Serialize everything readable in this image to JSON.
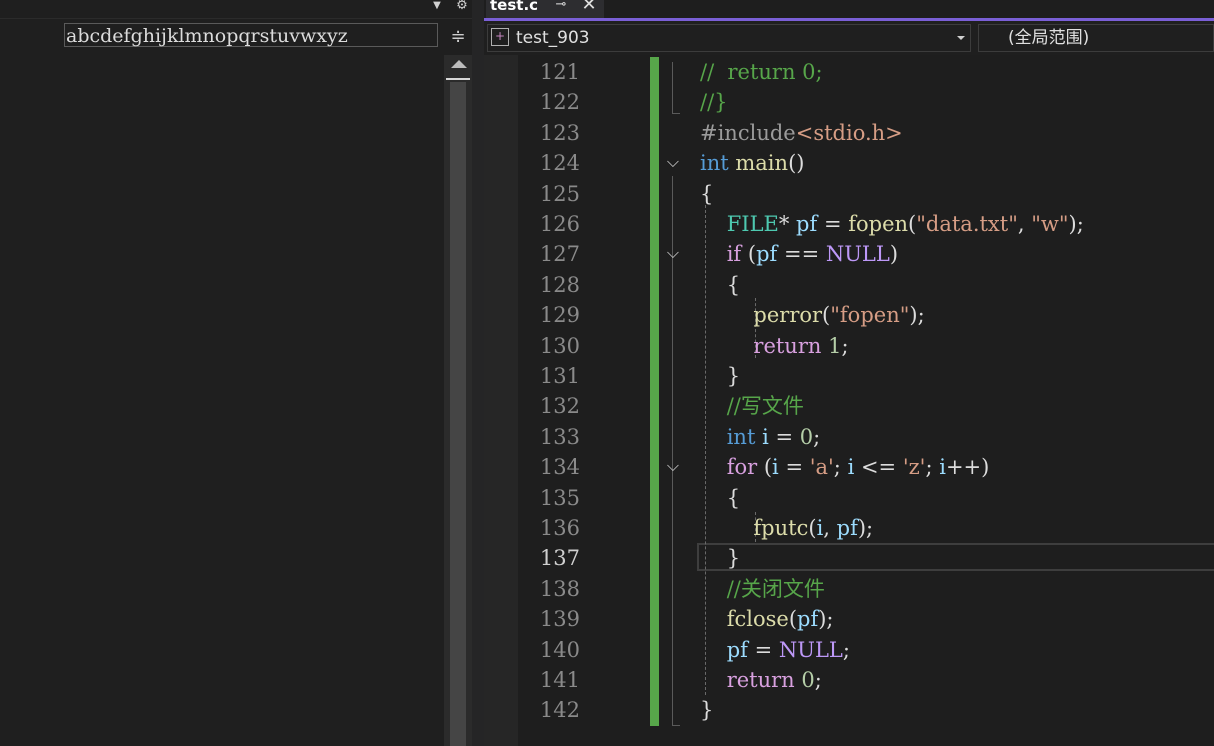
{
  "left_pane": {
    "output_text": "abcdefghijklmnopqrstuvwxyz"
  },
  "tab": {
    "label": "test.c"
  },
  "navbar": {
    "scope": "test_903",
    "global_scope": "(全局范围)"
  },
  "editor": {
    "current_line": "137",
    "lines": [
      {
        "n": "121",
        "tokens": [
          {
            "t": "//  return 0;",
            "c": "cmt"
          }
        ]
      },
      {
        "n": "122",
        "tokens": [
          {
            "t": "//}",
            "c": "cmt"
          }
        ]
      },
      {
        "n": "123",
        "tokens": [
          {
            "t": "#include",
            "c": "pre"
          },
          {
            "t": "<stdio.h>",
            "c": "str"
          }
        ]
      },
      {
        "n": "124",
        "tokens": [
          {
            "t": "int",
            "c": "kw"
          },
          {
            "t": " ",
            "c": ""
          },
          {
            "t": "main",
            "c": "fn"
          },
          {
            "t": "()",
            "c": ""
          }
        ]
      },
      {
        "n": "125",
        "tokens": [
          {
            "t": "{",
            "c": ""
          }
        ]
      },
      {
        "n": "126",
        "tokens": [
          {
            "t": "    ",
            "c": ""
          },
          {
            "t": "FILE",
            "c": "typ"
          },
          {
            "t": "* ",
            "c": ""
          },
          {
            "t": "pf",
            "c": "var"
          },
          {
            "t": " = ",
            "c": ""
          },
          {
            "t": "fopen",
            "c": "fn"
          },
          {
            "t": "(",
            "c": ""
          },
          {
            "t": "\"data.txt\"",
            "c": "str"
          },
          {
            "t": ", ",
            "c": ""
          },
          {
            "t": "\"w\"",
            "c": "str"
          },
          {
            "t": ");",
            "c": ""
          }
        ]
      },
      {
        "n": "127",
        "tokens": [
          {
            "t": "    ",
            "c": ""
          },
          {
            "t": "if",
            "c": "ctl"
          },
          {
            "t": " (",
            "c": ""
          },
          {
            "t": "pf",
            "c": "var"
          },
          {
            "t": " == ",
            "c": ""
          },
          {
            "t": "NULL",
            "c": "mac"
          },
          {
            "t": ")",
            "c": ""
          }
        ]
      },
      {
        "n": "128",
        "tokens": [
          {
            "t": "    {",
            "c": ""
          }
        ]
      },
      {
        "n": "129",
        "tokens": [
          {
            "t": "        ",
            "c": ""
          },
          {
            "t": "perror",
            "c": "fn"
          },
          {
            "t": "(",
            "c": ""
          },
          {
            "t": "\"fopen\"",
            "c": "str"
          },
          {
            "t": ");",
            "c": ""
          }
        ]
      },
      {
        "n": "130",
        "tokens": [
          {
            "t": "        ",
            "c": ""
          },
          {
            "t": "return",
            "c": "ctl"
          },
          {
            "t": " ",
            "c": ""
          },
          {
            "t": "1",
            "c": "num"
          },
          {
            "t": ";",
            "c": ""
          }
        ]
      },
      {
        "n": "131",
        "tokens": [
          {
            "t": "    }",
            "c": ""
          }
        ]
      },
      {
        "n": "132",
        "tokens": [
          {
            "t": "    ",
            "c": ""
          },
          {
            "t": "//写文件",
            "c": "cmt"
          }
        ]
      },
      {
        "n": "133",
        "tokens": [
          {
            "t": "    ",
            "c": ""
          },
          {
            "t": "int",
            "c": "kw"
          },
          {
            "t": " ",
            "c": ""
          },
          {
            "t": "i",
            "c": "var"
          },
          {
            "t": " = ",
            "c": ""
          },
          {
            "t": "0",
            "c": "num"
          },
          {
            "t": ";",
            "c": ""
          }
        ]
      },
      {
        "n": "134",
        "tokens": [
          {
            "t": "    ",
            "c": ""
          },
          {
            "t": "for",
            "c": "ctl"
          },
          {
            "t": " (",
            "c": ""
          },
          {
            "t": "i",
            "c": "var"
          },
          {
            "t": " = ",
            "c": ""
          },
          {
            "t": "'a'",
            "c": "str"
          },
          {
            "t": "; ",
            "c": ""
          },
          {
            "t": "i",
            "c": "var"
          },
          {
            "t": " <= ",
            "c": ""
          },
          {
            "t": "'z'",
            "c": "str"
          },
          {
            "t": "; ",
            "c": ""
          },
          {
            "t": "i",
            "c": "var"
          },
          {
            "t": "++)",
            "c": ""
          }
        ]
      },
      {
        "n": "135",
        "tokens": [
          {
            "t": "    {",
            "c": ""
          }
        ]
      },
      {
        "n": "136",
        "tokens": [
          {
            "t": "        ",
            "c": ""
          },
          {
            "t": "fputc",
            "c": "fn"
          },
          {
            "t": "(",
            "c": ""
          },
          {
            "t": "i",
            "c": "var"
          },
          {
            "t": ", ",
            "c": ""
          },
          {
            "t": "pf",
            "c": "var"
          },
          {
            "t": ");",
            "c": ""
          }
        ]
      },
      {
        "n": "137",
        "tokens": [
          {
            "t": "    }",
            "c": ""
          }
        ]
      },
      {
        "n": "138",
        "tokens": [
          {
            "t": "    ",
            "c": ""
          },
          {
            "t": "//关闭文件",
            "c": "cmt"
          }
        ]
      },
      {
        "n": "139",
        "tokens": [
          {
            "t": "    ",
            "c": ""
          },
          {
            "t": "fclose",
            "c": "fn"
          },
          {
            "t": "(",
            "c": ""
          },
          {
            "t": "pf",
            "c": "var"
          },
          {
            "t": ");",
            "c": ""
          }
        ]
      },
      {
        "n": "140",
        "tokens": [
          {
            "t": "    ",
            "c": ""
          },
          {
            "t": "pf",
            "c": "var"
          },
          {
            "t": " = ",
            "c": ""
          },
          {
            "t": "NULL",
            "c": "mac"
          },
          {
            "t": ";",
            "c": ""
          }
        ]
      },
      {
        "n": "141",
        "tokens": [
          {
            "t": "    ",
            "c": ""
          },
          {
            "t": "return",
            "c": "ctl"
          },
          {
            "t": " ",
            "c": ""
          },
          {
            "t": "0",
            "c": "num"
          },
          {
            "t": ";",
            "c": ""
          }
        ]
      },
      {
        "n": "142",
        "tokens": [
          {
            "t": "}",
            "c": ""
          }
        ]
      }
    ]
  }
}
